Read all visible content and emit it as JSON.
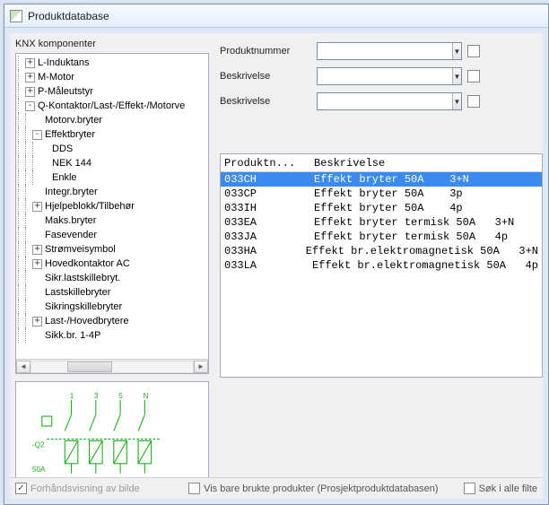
{
  "window": {
    "title": "Produktdatabase"
  },
  "tree": {
    "label": "KNX komponenter",
    "items": [
      {
        "indent": 1,
        "exp": "+",
        "label": "L-Induktans"
      },
      {
        "indent": 1,
        "exp": "+",
        "label": "M-Motor"
      },
      {
        "indent": 1,
        "exp": "+",
        "label": "P-Måleutstyr"
      },
      {
        "indent": 1,
        "exp": "-",
        "label": "Q-Kontaktor/Last-/Effekt-/Motorve"
      },
      {
        "indent": 2,
        "exp": "",
        "label": "Motorv.bryter"
      },
      {
        "indent": 2,
        "exp": "-",
        "label": "Effektbryter"
      },
      {
        "indent": 3,
        "exp": "",
        "label": "DDS"
      },
      {
        "indent": 3,
        "exp": "",
        "label": "NEK 144"
      },
      {
        "indent": 3,
        "exp": "",
        "label": "Enkle"
      },
      {
        "indent": 2,
        "exp": "",
        "label": "Integr.bryter"
      },
      {
        "indent": 2,
        "exp": "+",
        "label": "Hjelpeblokk/Tilbehør"
      },
      {
        "indent": 2,
        "exp": "",
        "label": "Maks.bryter"
      },
      {
        "indent": 2,
        "exp": "",
        "label": "Fasevender"
      },
      {
        "indent": 2,
        "exp": "+",
        "label": "Strømveisymbol"
      },
      {
        "indent": 2,
        "exp": "+",
        "label": "Hovedkontaktor AC"
      },
      {
        "indent": 2,
        "exp": "",
        "label": "Sikr.lastskillebryt."
      },
      {
        "indent": 2,
        "exp": "",
        "label": "Lastskillebryter"
      },
      {
        "indent": 2,
        "exp": "",
        "label": "Sikringskillebryter"
      },
      {
        "indent": 2,
        "exp": "+",
        "label": "Last-/Hovedbrytere"
      },
      {
        "indent": 2,
        "exp": "",
        "label": "Sikk.br. 1-4P"
      }
    ]
  },
  "filters": {
    "rows": [
      {
        "label": "Produktnummer",
        "value": ""
      },
      {
        "label": "Beskrivelse",
        "value": ""
      },
      {
        "label": "Beskrivelse",
        "value": ""
      }
    ]
  },
  "grid": {
    "headers": {
      "c1": "Produktn...",
      "c2": "Beskrivelse"
    },
    "rows": [
      {
        "c1": "033CH",
        "c2": "Effekt bryter 50A    3+N",
        "sel": true
      },
      {
        "c1": "033CP",
        "c2": "Effekt bryter 50A    3p"
      },
      {
        "c1": "033IH",
        "c2": "Effekt bryter 50A    4p"
      },
      {
        "c1": "033EA",
        "c2": "Effekt bryter termisk 50A   3+N"
      },
      {
        "c1": "033JA",
        "c2": "Effekt bryter termisk 50A   4p"
      },
      {
        "c1": "033HA",
        "c2": "Effekt br.elektromagnetisk 50A   3+N"
      },
      {
        "c1": "033LA",
        "c2": "Effekt br.elektromagnetisk 50A   4p"
      }
    ]
  },
  "preview": {
    "label_q": "-Q2",
    "label_amp": "50A",
    "terms": [
      "1",
      "3",
      "5",
      "N"
    ]
  },
  "bottom": {
    "preview_chk": {
      "label": "Forhåndsvisning av bilde",
      "checked": true,
      "disabled": true
    },
    "used_chk": {
      "label": "Vis bare brukte produkter (Prosjektproduktdatabasen)",
      "checked": false
    },
    "search_chk": {
      "label": "Søk i alle filte",
      "checked": false
    }
  }
}
